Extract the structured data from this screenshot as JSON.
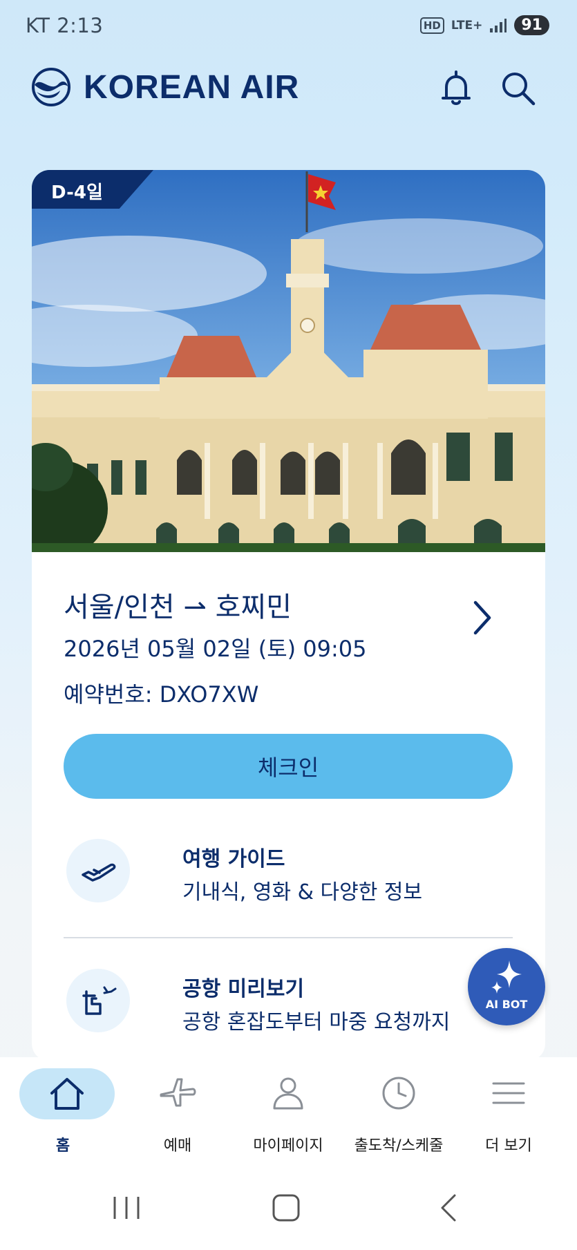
{
  "status_bar": {
    "time": "KT 2:13",
    "hd": "HD",
    "network": "LTE+",
    "battery": "91"
  },
  "header": {
    "brand": "KOREAN AIR",
    "bell_icon": "bell-icon",
    "search_icon": "search-icon"
  },
  "trip_card": {
    "dday_badge": "D-4일",
    "route": "서울/인천 ⇀ 호찌민",
    "datetime": "2026년 05월 02일 (토) 09:05",
    "booking_ref": "예약번호: DXO7XW",
    "checkin_label": "체크인",
    "services": [
      {
        "title": "여행 가이드",
        "subtitle": "기내식, 영화 & 다양한 정보",
        "icon": "airplane-icon"
      },
      {
        "title": "공항 미리보기",
        "subtitle": "공항 혼잡도부터 마중 요청까지",
        "icon": "airport-icon"
      }
    ]
  },
  "ai_bot": {
    "label": "AI BOT",
    "icon": "sparkle-icon"
  },
  "bottom_nav": {
    "items": [
      {
        "label": "홈",
        "icon": "home-icon",
        "active": true
      },
      {
        "label": "예매",
        "icon": "plane-icon",
        "active": false
      },
      {
        "label": "마이페이지",
        "icon": "user-icon",
        "active": false
      },
      {
        "label": "출도착/스케줄",
        "icon": "clock-icon",
        "active": false
      },
      {
        "label": "더 보기",
        "icon": "menu-icon",
        "active": false
      }
    ]
  },
  "colors": {
    "navy": "#0c2d6b",
    "checkin_blue": "#5bbbec",
    "active_pill": "#c6e6f8",
    "ai_bot": "#2f5bb8"
  }
}
